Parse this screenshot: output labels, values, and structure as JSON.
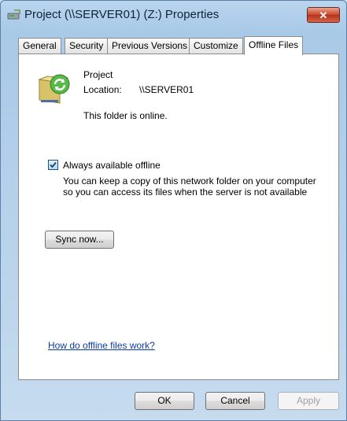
{
  "window": {
    "title": "Project (\\\\SERVER01) (Z:) Properties",
    "close_glyph": "✕"
  },
  "tabs": [
    {
      "label": "General"
    },
    {
      "label": "Security"
    },
    {
      "label": "Previous Versions"
    },
    {
      "label": "Customize"
    },
    {
      "label": "Offline Files",
      "active": true
    }
  ],
  "panel": {
    "folder_name": "Project",
    "location_label": "Location:",
    "location_value": "\\\\SERVER01",
    "status": "This folder is online.",
    "always_available": {
      "label": "Always available offline",
      "checked": true,
      "description_line1": "You can keep a copy of this network folder on your computer",
      "description_line2": "so you can access its files when the server is not available"
    },
    "sync_button": "Sync now...",
    "help_link": "How do offline files work?"
  },
  "footer": {
    "ok": "OK",
    "cancel": "Cancel",
    "apply": "Apply"
  },
  "colors": {
    "link": "#0a3aa6",
    "close_button": "#c9442a",
    "disabled_text": "#a0a0a0"
  }
}
